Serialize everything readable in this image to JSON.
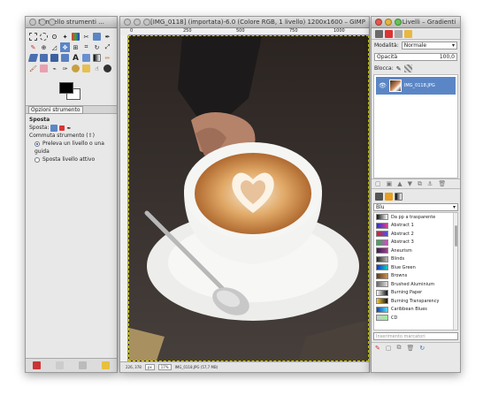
{
  "toolbox": {
    "title": "Pannello strumenti ...",
    "tab_label": "Opzioni strumento",
    "section_title": "Sposta",
    "move_label": "Sposta:",
    "switch_label": "Commuta strumento (⇧)",
    "options": [
      {
        "label": "Preleva un livello o una guida",
        "selected": true
      },
      {
        "label": "Sposta livello attivo",
        "selected": false
      }
    ]
  },
  "image_window": {
    "title": "[IMG_0118] (importata)-6.0 (Colore RGB, 1 livello) 1200x1600 – GIMP",
    "ruler_labels": [
      "0",
      "250",
      "500",
      "750",
      "1000"
    ],
    "status": {
      "coords": "226, 378",
      "unit": "px",
      "zoom": "17%",
      "info": "IMG_0118.JPG (57,7 MB)"
    }
  },
  "layers_window": {
    "title": "Livelli – Gradienti",
    "mode_label": "Modalità:",
    "mode_value": "Normale",
    "opacity_label": "Opacità",
    "opacity_value": "100,0",
    "lock_label": "Blocca:",
    "layer_name": "IMG_0118.JPG",
    "gradient_filter": "Blu",
    "gradients": [
      {
        "name": "Da pp a trasparente",
        "colors": [
          "#111111",
          "#ffffff"
        ]
      },
      {
        "name": "Abstract 1",
        "colors": [
          "#2233dd",
          "#e0408a"
        ]
      },
      {
        "name": "Abstract 2",
        "colors": [
          "#dd2222",
          "#4455ee"
        ]
      },
      {
        "name": "Abstract 3",
        "colors": [
          "#22bb44",
          "#dd44cc"
        ]
      },
      {
        "name": "Aneurism",
        "colors": [
          "#3a1a4a",
          "#a04090"
        ]
      },
      {
        "name": "Blinds",
        "colors": [
          "#222222",
          "#bbbbbb"
        ]
      },
      {
        "name": "Blue Green",
        "colors": [
          "#1133cc",
          "#11ccbb"
        ]
      },
      {
        "name": "Browns",
        "colors": [
          "#5a3a1a",
          "#c89050"
        ]
      },
      {
        "name": "Brushed Aluminium",
        "colors": [
          "#666666",
          "#dddddd"
        ]
      },
      {
        "name": "Burning Paper",
        "colors": [
          "#ffffff",
          "#111111"
        ]
      },
      {
        "name": "Burning Transparency",
        "colors": [
          "#ffcc33",
          "#111111"
        ]
      },
      {
        "name": "Caribbean Blues",
        "colors": [
          "#1144aa",
          "#55ddee"
        ]
      },
      {
        "name": "CD",
        "colors": [
          "#cccccc",
          "#99ee99"
        ]
      }
    ],
    "find_placeholder": "Inserimento marcatori"
  }
}
